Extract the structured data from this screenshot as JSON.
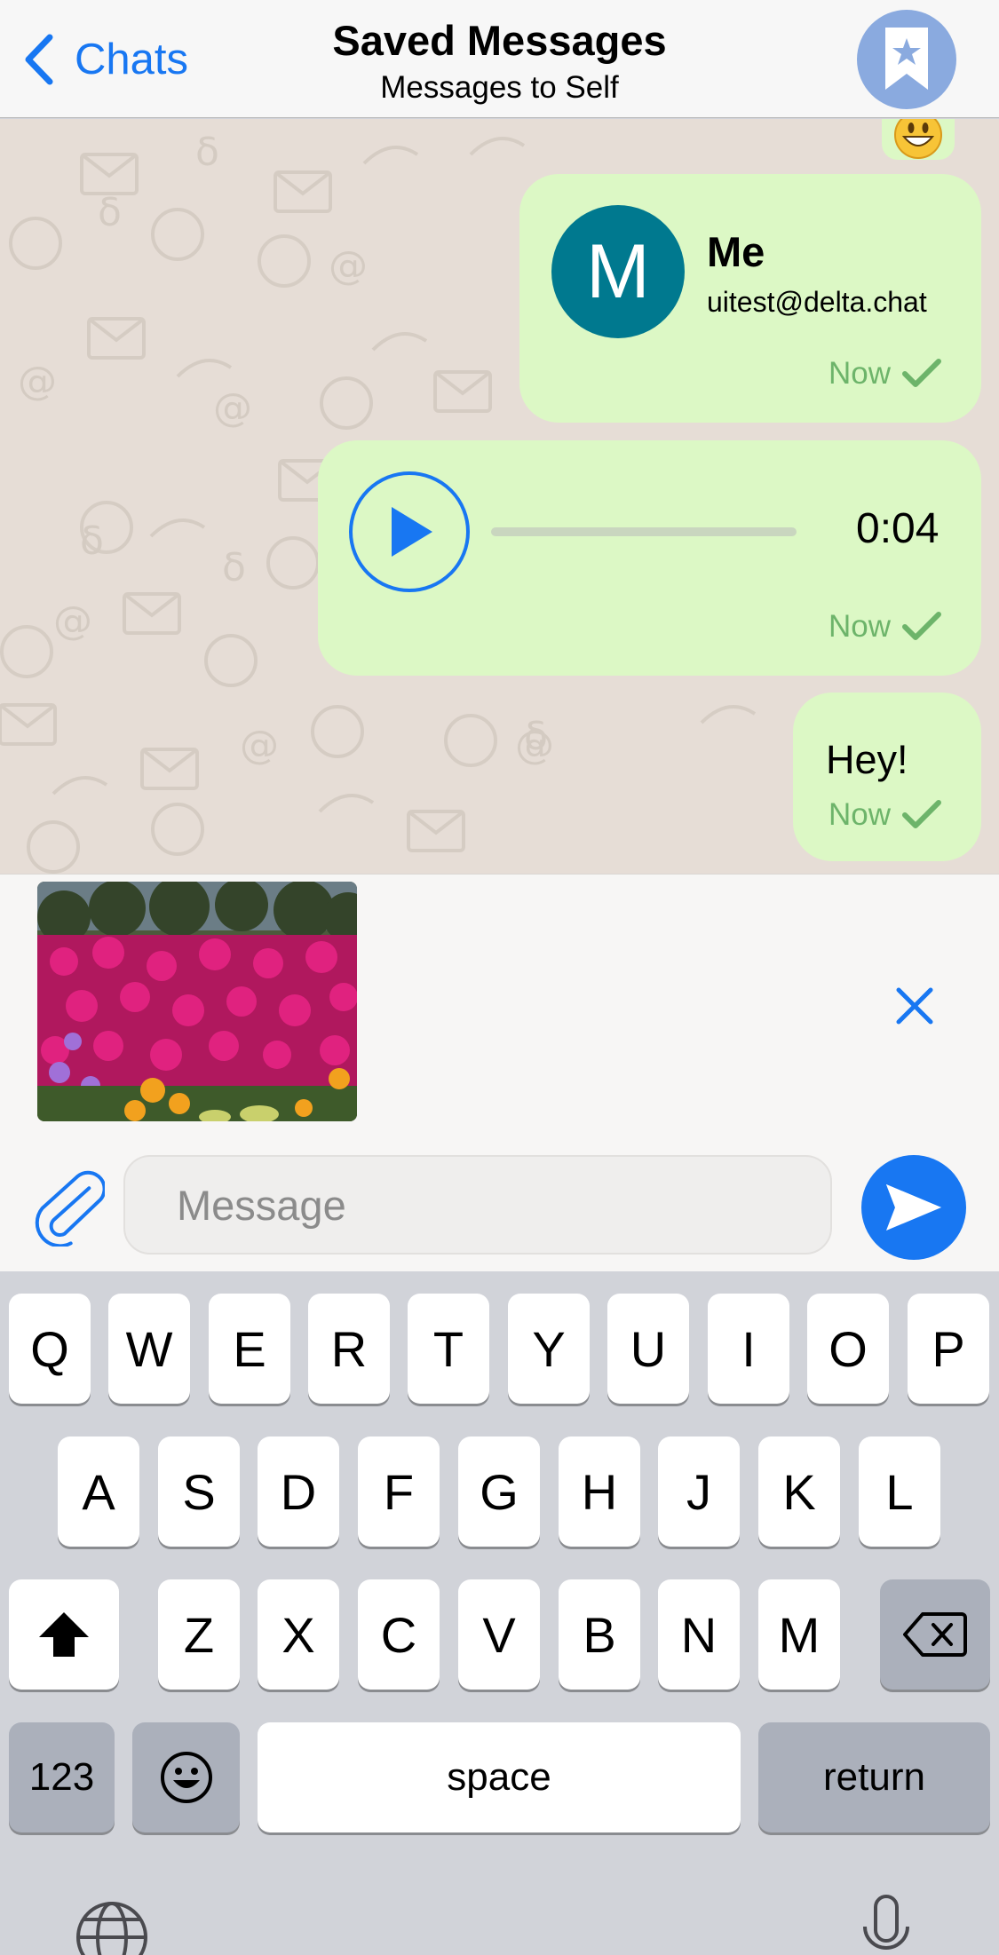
{
  "header": {
    "back_label": "Chats",
    "title": "Saved Messages",
    "subtitle": "Messages to Self",
    "avatar_icon": "bookmark-star-icon"
  },
  "messages": {
    "contact": {
      "avatar_letter": "M",
      "name": "Me",
      "email": "uitest@delta.chat",
      "time": "Now"
    },
    "audio": {
      "duration": "0:04",
      "time": "Now"
    },
    "text": {
      "body": "Hey!",
      "time": "Now"
    }
  },
  "composer": {
    "placeholder": "Message"
  },
  "keyboard": {
    "row1": [
      "Q",
      "W",
      "E",
      "R",
      "T",
      "Y",
      "U",
      "I",
      "O",
      "P"
    ],
    "row2": [
      "A",
      "S",
      "D",
      "F",
      "G",
      "H",
      "J",
      "K",
      "L"
    ],
    "row3": [
      "Z",
      "X",
      "C",
      "V",
      "B",
      "N",
      "M"
    ],
    "numbers": "123",
    "space": "space",
    "return": "return"
  },
  "colors": {
    "accent": "#1877f2",
    "bubble": "#dcf8c5",
    "check": "#6db46a",
    "avatar": "#00798f"
  }
}
